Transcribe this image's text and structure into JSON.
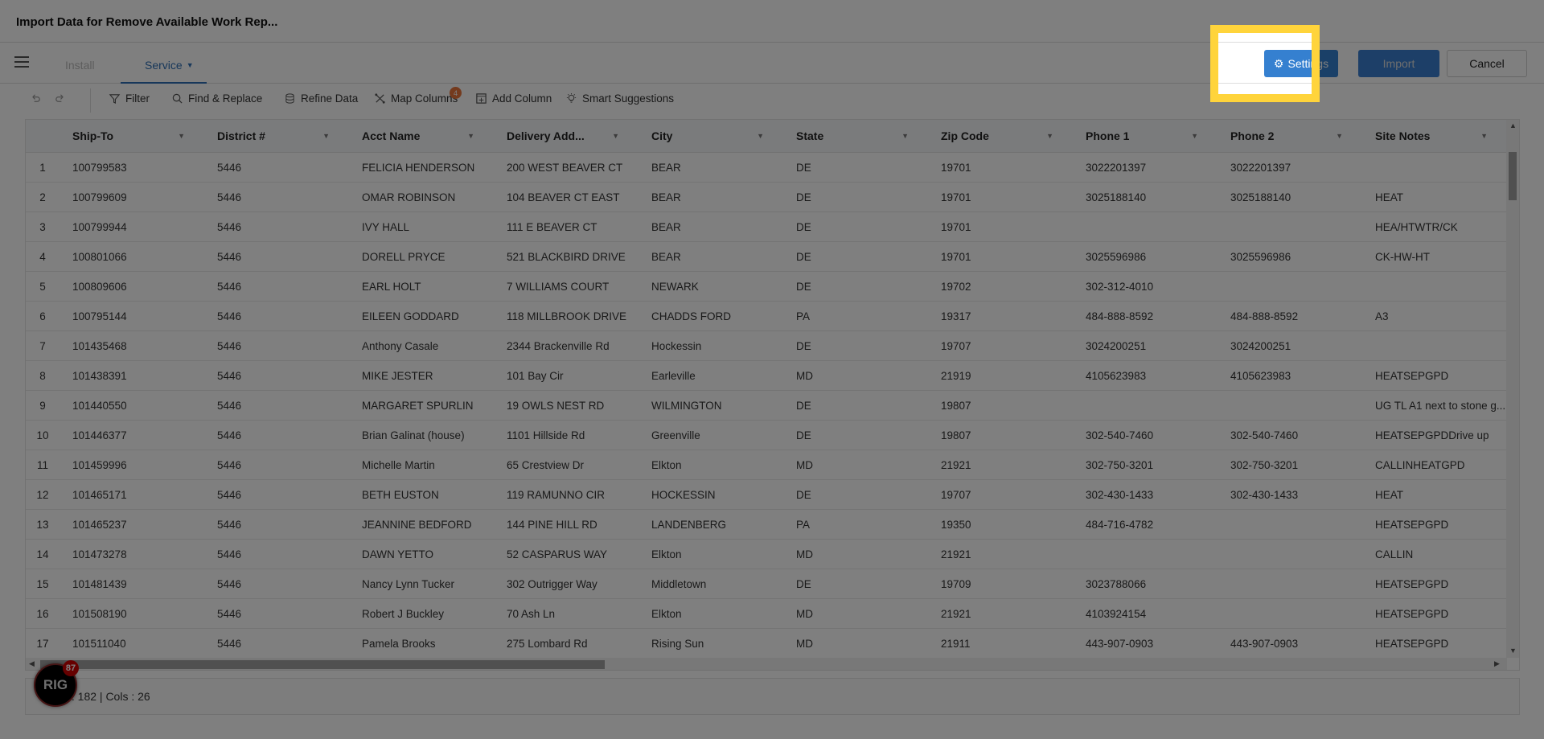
{
  "header": {
    "title": "Import Data for Remove Available Work Rep..."
  },
  "tabs": [
    {
      "label": "Install"
    },
    {
      "label": "Service",
      "active": true
    }
  ],
  "actions": {
    "settings": "Settings",
    "import": "Import",
    "cancel": "Cancel"
  },
  "toolbar": {
    "filter": "Filter",
    "find_replace": "Find & Replace",
    "refine": "Refine Data",
    "map_columns": "Map Columns",
    "map_badge": "4",
    "add_column": "Add Column",
    "smart": "Smart Suggestions"
  },
  "columns": [
    "Ship-To",
    "District #",
    "Acct Name",
    "Delivery Add...",
    "City",
    "State",
    "Zip Code",
    "Phone 1",
    "Phone 2",
    "Site Notes"
  ],
  "rows": [
    [
      "1",
      "100799583",
      "5446",
      "FELICIA HENDERSON",
      "200 WEST BEAVER CT",
      "BEAR",
      "DE",
      "19701",
      "3022201397",
      "3022201397",
      ""
    ],
    [
      "2",
      "100799609",
      "5446",
      "OMAR ROBINSON",
      "104 BEAVER CT EAST",
      "BEAR",
      "DE",
      "19701",
      "3025188140",
      "3025188140",
      "HEAT"
    ],
    [
      "3",
      "100799944",
      "5446",
      "IVY HALL",
      "111 E BEAVER CT",
      "BEAR",
      "DE",
      "19701",
      "",
      "",
      "HEA/HTWTR/CK"
    ],
    [
      "4",
      "100801066",
      "5446",
      "DORELL PRYCE",
      "521 BLACKBIRD DRIVE",
      "BEAR",
      "DE",
      "19701",
      "3025596986",
      "3025596986",
      "CK-HW-HT"
    ],
    [
      "5",
      "100809606",
      "5446",
      "EARL HOLT",
      "7 WILLIAMS COURT",
      "NEWARK",
      "DE",
      "19702",
      "302-312-4010",
      "",
      ""
    ],
    [
      "6",
      "100795144",
      "5446",
      "EILEEN GODDARD",
      "118 MILLBROOK DRIVE",
      "CHADDS FORD",
      "PA",
      "19317",
      "484-888-8592",
      "484-888-8592",
      "A3"
    ],
    [
      "7",
      "101435468",
      "5446",
      "Anthony Casale",
      "2344 Brackenville Rd",
      "Hockessin",
      "DE",
      "19707",
      "3024200251",
      "3024200251",
      ""
    ],
    [
      "8",
      "101438391",
      "5446",
      "MIKE JESTER",
      "101 Bay Cir",
      "Earleville",
      "MD",
      "21919",
      "4105623983",
      "4105623983",
      "HEATSEPGPD"
    ],
    [
      "9",
      "101440550",
      "5446",
      "MARGARET SPURLIN",
      "19 OWLS NEST RD",
      "WILMINGTON",
      "DE",
      "19807",
      "",
      "",
      "UG TL A1 next to stone g..."
    ],
    [
      "10",
      "101446377",
      "5446",
      "Brian Galinat (house)",
      "1101 Hillside Rd",
      "Greenville",
      "DE",
      "19807",
      "302-540-7460",
      "302-540-7460",
      "HEATSEPGPDDrive up"
    ],
    [
      "11",
      "101459996",
      "5446",
      "Michelle Martin",
      "65 Crestview Dr",
      "Elkton",
      "MD",
      "21921",
      "302-750-3201",
      "302-750-3201",
      "CALLINHEATGPD"
    ],
    [
      "12",
      "101465171",
      "5446",
      "BETH EUSTON",
      "119 RAMUNNO CIR",
      "HOCKESSIN",
      "DE",
      "19707",
      "302-430-1433",
      "302-430-1433",
      "HEAT"
    ],
    [
      "13",
      "101465237",
      "5446",
      "JEANNINE BEDFORD",
      "144 PINE HILL RD",
      "LANDENBERG",
      "PA",
      "19350",
      "484-716-4782",
      "",
      "HEATSEPGPD"
    ],
    [
      "14",
      "101473278",
      "5446",
      "DAWN YETTO",
      "52 CASPARUS WAY",
      "Elkton",
      "MD",
      "21921",
      "",
      "",
      "CALLIN"
    ],
    [
      "15",
      "101481439",
      "5446",
      "Nancy Lynn Tucker",
      "302 Outrigger Way",
      "Middletown",
      "DE",
      "19709",
      "3023788066",
      "",
      "HEATSEPGPD"
    ],
    [
      "16",
      "101508190",
      "5446",
      "Robert J Buckley",
      "70 Ash Ln",
      "Elkton",
      "MD",
      "21921",
      "4103924154",
      "",
      "HEATSEPGPD"
    ],
    [
      "17",
      "101511040",
      "5446",
      "Pamela Brooks",
      "275 Lombard Rd",
      "Rising Sun",
      "MD",
      "21911",
      "443-907-0903",
      "443-907-0903",
      "HEATSEPGPD"
    ]
  ],
  "footer": {
    "summary": "Rows : 182 | Cols : 26"
  },
  "assistant": {
    "logo": "RIG",
    "badge": "87"
  },
  "colors": {
    "accent": "#3580d0",
    "highlight": "#ffd43b",
    "badge": "#e8743b"
  }
}
